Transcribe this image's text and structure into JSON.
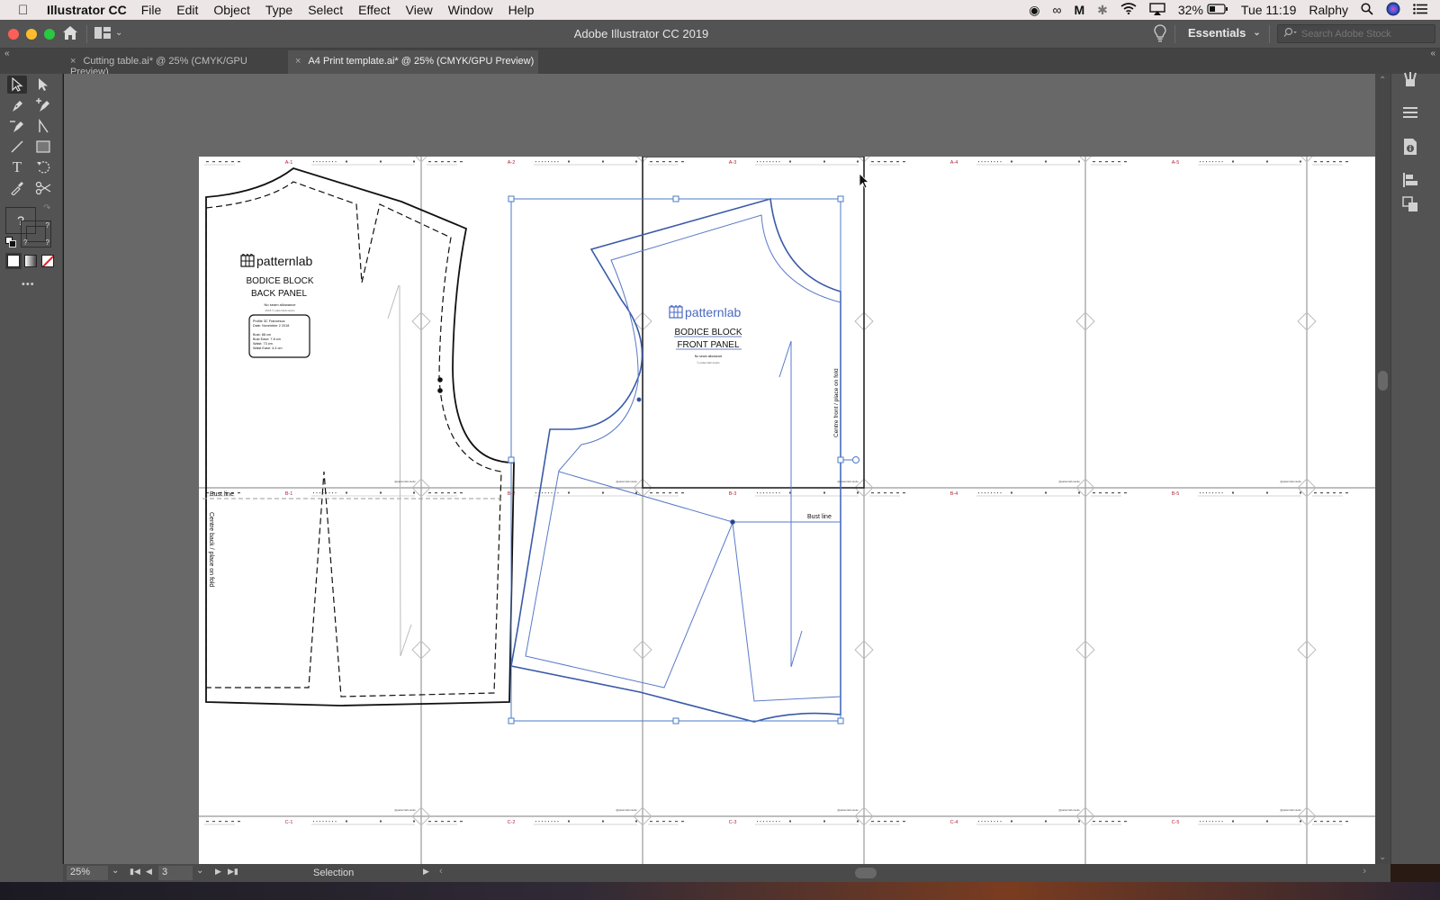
{
  "menubar": {
    "app_name": "Illustrator CC",
    "items": [
      "File",
      "Edit",
      "Object",
      "Type",
      "Select",
      "Effect",
      "View",
      "Window",
      "Help"
    ],
    "battery": "32%",
    "clock": "Tue 11:19",
    "user": "Ralphy"
  },
  "window": {
    "title": "Adobe Illustrator CC 2019",
    "workspace": "Essentials",
    "search_placeholder": "Search Adobe Stock"
  },
  "tabs": [
    {
      "label": "Cutting table.ai* @ 25% (CMYK/GPU Preview)",
      "active": false
    },
    {
      "label": "A4 Print template.ai* @ 25% (CMYK/GPU Preview)",
      "active": true
    }
  ],
  "toolbar": {
    "tools": [
      "selection-tool",
      "direct-selection-tool",
      "pen-tool",
      "add-anchor-point-tool",
      "delete-anchor-point-tool",
      "anchor-point-tool",
      "line-segment-tool",
      "rectangle-tool",
      "type-tool",
      "rotate-tool",
      "eyedropper-tool",
      "scissors-tool"
    ],
    "fill_label": "?",
    "stroke_labels": [
      "?",
      "?",
      "?"
    ],
    "more_label": "•••"
  },
  "statusbar": {
    "zoom": "25%",
    "artboard_number": "3",
    "tool_status": "Selection"
  },
  "artboard": {
    "page_labels_row_a": [
      "A-1",
      "A-2",
      "A-3",
      "A-4",
      "A-5"
    ],
    "page_labels_row_b": [
      "B-1",
      "B-2",
      "B-3",
      "B-4",
      "B-5"
    ],
    "page_labels_row_c": [
      "C-1",
      "C-2",
      "C-3",
      "C-4",
      "C-5"
    ],
    "back_panel": {
      "brand": "patternlab",
      "title_line1": "BODICE BLOCK",
      "title_line2": "BACK PANEL",
      "note": "No seam allowance",
      "copyright": "2018 © patternlab.studio",
      "info_lines": [
        "Profile 3C Francesca",
        "Date: November 2 2018",
        "",
        "Bust: 88 cm",
        "Bust Ease: 7.8 cm",
        "Waist: 73 cm",
        "Waist Ease: 4.4 cm"
      ],
      "bust_line_label": "Bust line",
      "fold_label": "Centre back / place on fold"
    },
    "front_panel": {
      "brand": "patternlab",
      "title_line1": "BODICE BLOCK",
      "title_line2": "FRONT PANEL",
      "note": "No seam allowance",
      "copyright": "© patternlab.studio",
      "bust_line_label": "Bust line",
      "fold_label": "Centre front / place on fold"
    },
    "footer_mark": "@patternlab.studio"
  },
  "colors": {
    "selection_blue": "#4a78c8",
    "page_label_red": "#b0243a",
    "canvas_bg": "#686868",
    "panel_bg": "#535353"
  }
}
